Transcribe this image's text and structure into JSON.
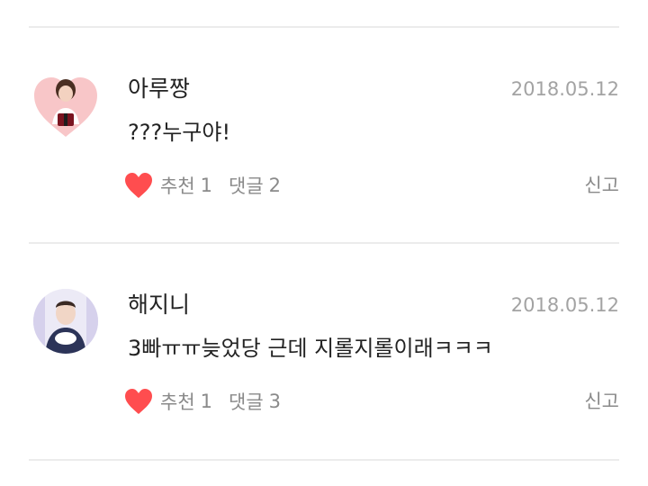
{
  "colors": {
    "divider": "#ececec",
    "heart": "#ff4d4f",
    "meta_text": "#8a8a8a",
    "date_text": "#a3a3a3",
    "primary_text": "#222222"
  },
  "comments": [
    {
      "username": "아루짱",
      "date": "2018.05.12",
      "text": "???누구야!",
      "like_label": "추천",
      "like_count": "1",
      "reply_label": "댓글",
      "reply_count": "2",
      "report_label": "신고",
      "avatar_icon": "heart-shaped-profile-photo"
    },
    {
      "username": "해지니",
      "date": "2018.05.12",
      "text": "3빠ㅠㅠ늦었당 근데 지롤지롤이래ㅋㅋㅋ",
      "like_label": "추천",
      "like_count": "1",
      "reply_label": "댓글",
      "reply_count": "3",
      "report_label": "신고",
      "avatar_icon": "circular-profile-photo"
    }
  ]
}
